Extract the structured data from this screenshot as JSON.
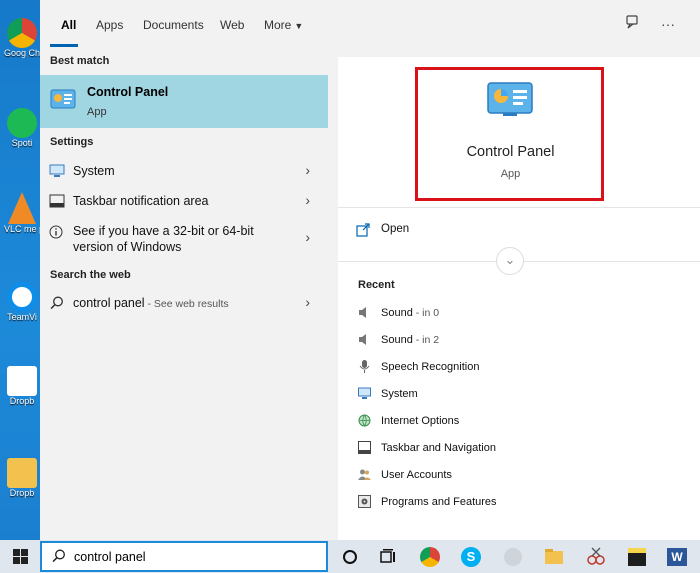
{
  "tabs": [
    {
      "label": "All"
    },
    {
      "label": "Apps"
    },
    {
      "label": "Documents"
    },
    {
      "label": "Web"
    },
    {
      "label": "More"
    }
  ],
  "desktop_labels": [
    "Goog Chron",
    "Spoti",
    "VLC me playe",
    "TeamVi",
    "Dropb",
    "Dropb"
  ],
  "left": {
    "best_match_header": "Best match",
    "best_match": {
      "title": "Control Panel",
      "subtitle": "App"
    },
    "settings_header": "Settings",
    "settings": [
      {
        "label": "System"
      },
      {
        "label": "Taskbar notification area"
      },
      {
        "label_line1": "See if you have a 32-bit or 64-bit",
        "label_line2": "version of Windows"
      }
    ],
    "web_header": "Search the web",
    "web_result": {
      "query": "control panel",
      "hint": " - See web results"
    }
  },
  "right": {
    "app_title": "Control Panel",
    "app_subtitle": "App",
    "open_label": "Open",
    "recent_header": "Recent",
    "recent": [
      {
        "label": "Sound",
        "hint": " - in 0"
      },
      {
        "label": "Sound",
        "hint": " - in 2"
      },
      {
        "label": "Speech Recognition",
        "hint": ""
      },
      {
        "label": "System",
        "hint": ""
      },
      {
        "label": "Internet Options",
        "hint": ""
      },
      {
        "label": "Taskbar and Navigation",
        "hint": ""
      },
      {
        "label": "User Accounts",
        "hint": ""
      },
      {
        "label": "Programs and Features",
        "hint": ""
      }
    ]
  },
  "taskbar": {
    "search_value": "control panel"
  },
  "colors": {
    "accent": "#0063b1",
    "highlight": "#9fd6e2",
    "red_box": "#d9121a",
    "desktop": "#1c84d2"
  }
}
